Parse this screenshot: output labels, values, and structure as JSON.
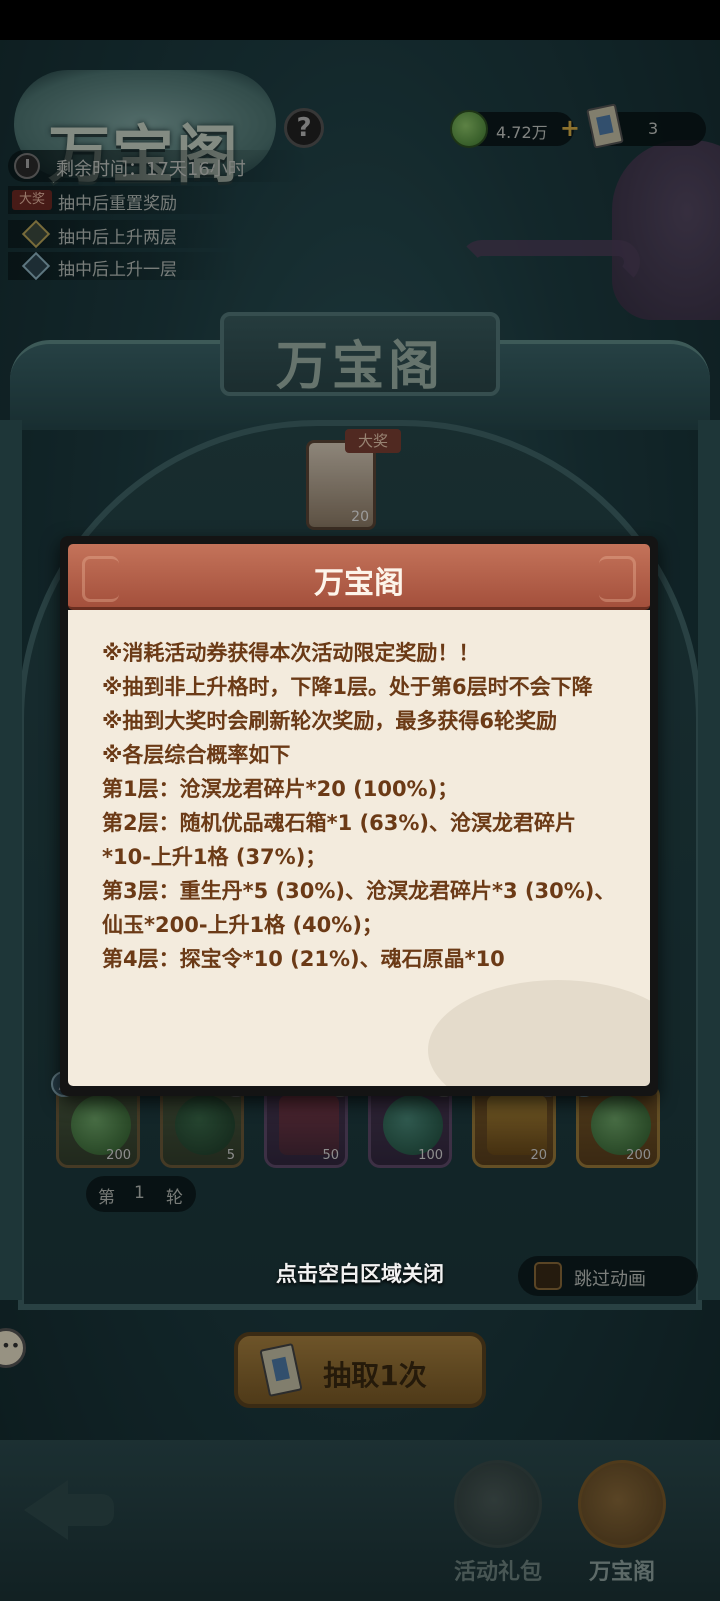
{
  "header": {
    "logo_text": "万宝阁",
    "help_symbol": "?",
    "timer_text": "剩余时间：17天16小时",
    "legend": [
      {
        "badge": "大奖",
        "text": "抽中后重置奖励"
      },
      {
        "text": "抽中后上升两层"
      },
      {
        "text": "抽中后上升一层"
      }
    ],
    "currency_amount": "4.72万",
    "currency_plus": "+",
    "ticket_count": "3"
  },
  "scene": {
    "sign_text": "万宝阁",
    "grand_prize_tag": "大奖",
    "grand_prize_qty": "20"
  },
  "slots": [
    {
      "qty": "200",
      "marker": "up"
    },
    {
      "qty": "5",
      "count": "0"
    },
    {
      "qty": "50",
      "count": "0"
    },
    {
      "qty": "100",
      "count": "0"
    },
    {
      "qty": "20",
      "count": "0"
    },
    {
      "qty": "200",
      "marker": "up"
    }
  ],
  "round": {
    "prefix": "第",
    "number": "1",
    "suffix": "轮"
  },
  "skip_animation": "跳过动画",
  "close_hint": "点击空白区域关闭",
  "draw_button": "抽取1次",
  "nav": {
    "tab_gift": "活动礼包",
    "tab_treasure": "万宝阁"
  },
  "modal": {
    "title": "万宝阁",
    "rules": [
      "※消耗活动券获得本次活动限定奖励！！",
      "※抽到非上升格时，下降1层。处于第6层时不会下降",
      "※抽到大奖时会刷新轮次奖励，最多获得6轮奖励",
      "※各层综合概率如下",
      "第1层：沧溟龙君碎片*20 (100%)；",
      "第2层：随机优品魂石箱*1 (63%)、沧溟龙君碎片*10-上升1格 (37%)；",
      "第3层：重生丹*5 (30%)、沧溟龙君碎片*3 (30%)、仙玉*200-上升1格 (40%)；",
      "第4层：探宝令*10 (21%)、魂石原晶*10"
    ]
  },
  "colors": {
    "modal_header": "#b25f47",
    "modal_body": "#f3ebdd",
    "rule_text": "#6b3a16"
  }
}
